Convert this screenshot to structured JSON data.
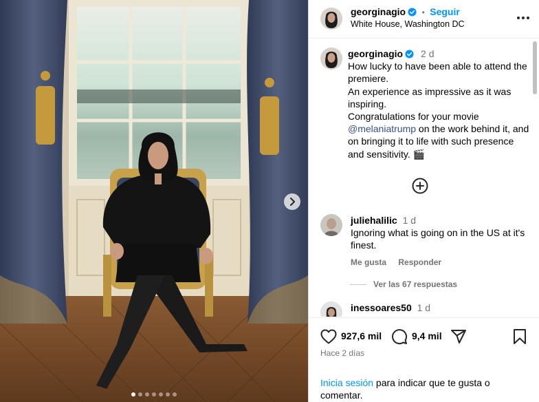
{
  "post": {
    "author": "georginagio",
    "follow_label": "Seguir",
    "separator": "•",
    "location": "White House, Washington DC",
    "more_icon": "more-horizontal-icon"
  },
  "caption": {
    "author": "georginagio",
    "age": "2 d",
    "line1": "How lucky to have been able to attend the premiere.",
    "line2": "An experience as impressive as it was inspiring.",
    "line3_pre": "Congratulations for your movie ",
    "mention": "@melaniatrump",
    "line3_post": " on the work behind it, and on bringing it to life with such presence and sensitivity. 🎬"
  },
  "comments": [
    {
      "author": "juliehalilic",
      "age": "1 d",
      "text": "Ignoring what is going on in the US at it's finest.",
      "like_label": "Me gusta",
      "reply_label": "Responder",
      "view_replies": "Ver las 67 respuestas"
    },
    {
      "author": "inessoares50",
      "age": "1 d"
    }
  ],
  "engagement": {
    "likes": "927,6 mil",
    "comments": "9,4 mil",
    "time": "Hace 2 días"
  },
  "login": {
    "link": "Inicia sesión",
    "rest": " para indicar que te gusta o comentar."
  },
  "carousel": {
    "count": 7,
    "active_index": 0
  },
  "colors": {
    "link_blue": "#0095f6",
    "mention": "#385185",
    "muted": "#737373"
  }
}
